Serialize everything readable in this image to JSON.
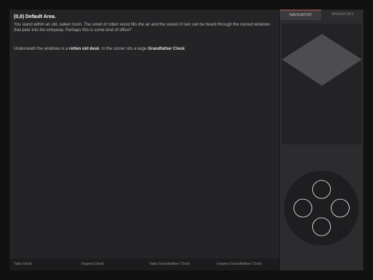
{
  "room": {
    "title": "(0,0) Default Area.",
    "description": "You stand within an old, oaken room. The smell of rotten wood fills the air and the sound of rain can be heard through the curved windows that peer into the entryway. Perhaps this is some kind of office?",
    "items_prefix": "Underneath the windows is a ",
    "item1": "rotten old desk",
    "items_middle": ". In the corner sits a large ",
    "item2": "Grandfather Clock",
    "items_suffix": "."
  },
  "actions": [
    {
      "label": "Take Desk"
    },
    {
      "label": "Inspect Desk"
    },
    {
      "label": "Take Grandfather Clock"
    },
    {
      "label": "Inspect Grandfather Clock"
    }
  ],
  "tabs": {
    "navigator": "NAVIGATOR",
    "inventory": "INVENTORY"
  },
  "colors": {
    "background": "#111111",
    "panel": "#242426",
    "side_panel": "#2c2c2e",
    "map_tile": "#4d4d50",
    "tab_accent": "#c85a5a",
    "dpad_button": "#ffffff"
  },
  "icons": {
    "map_tile": "isometric-tile-icon",
    "dpad_up": "circle-outline-icon",
    "dpad_left": "circle-outline-icon",
    "dpad_right": "circle-outline-icon",
    "dpad_down": "circle-outline-icon"
  }
}
